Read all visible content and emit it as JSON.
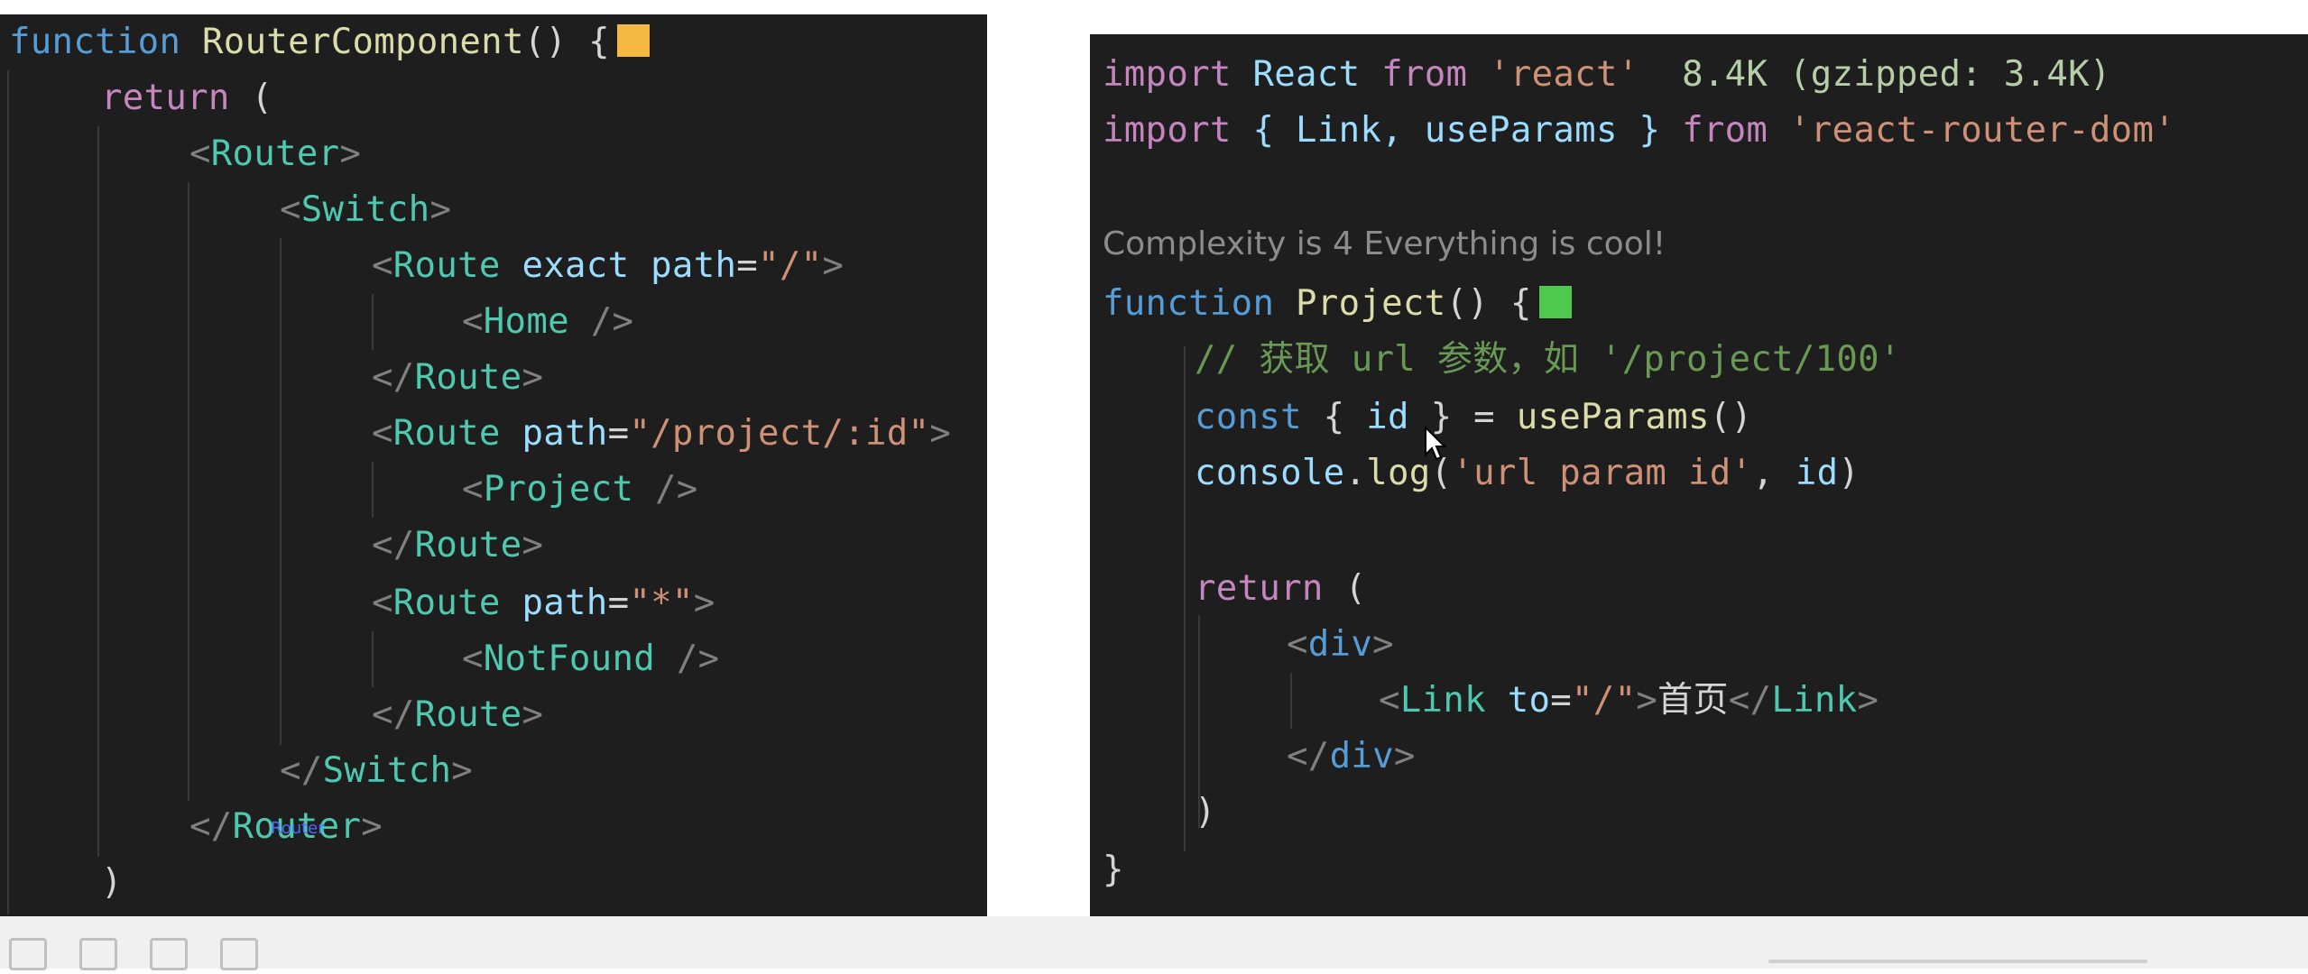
{
  "left_code": {
    "line1": {
      "kw": "function",
      "name": "RouterComponent",
      "rest": "() {"
    },
    "line2": {
      "kw": "return",
      "rest": " ("
    },
    "router_open": "Router",
    "switch_open": "Switch",
    "route1": {
      "tag": "Route",
      "attr1": "exact",
      "attr2": "path",
      "value": "\"/\""
    },
    "home": "Home",
    "route_close": "Route",
    "route2": {
      "tag": "Route",
      "attr": "path",
      "value": "\"/project/:id\""
    },
    "project": "Project",
    "route3": {
      "tag": "Route",
      "attr": "path",
      "value": "\"*\""
    },
    "notfound": "NotFound",
    "switch_close": "Switch",
    "router_close": "Router",
    "close_paren": ")",
    "close_brace": "}",
    "swatch_color": "#f5b942"
  },
  "right_code": {
    "import1": {
      "kw": "import",
      "name": "React",
      "from": "from",
      "module": "'react'",
      "size": "8.4K (gzipped: 3.4K)"
    },
    "import2": {
      "kw": "import",
      "names": "{ Link, useParams }",
      "from": "from",
      "module": "'react-router-dom'"
    },
    "lint_message": "Complexity is 4 Everything is cool!",
    "fn_line": {
      "kw": "function",
      "name": "Project",
      "rest": "() {"
    },
    "comment": "// 获取 url 参数，如 '/project/100'",
    "const_line": {
      "kw": "const",
      "open": " { ",
      "var": "id",
      "close": " } = ",
      "call": "useParams",
      "args": "()"
    },
    "console_line": {
      "obj": "console",
      "dot": ".",
      "method": "log",
      "open": "(",
      "str": "'url param id'",
      "sep": ", ",
      "var": "id",
      "close": ")"
    },
    "return_line": {
      "kw": "return",
      "rest": " ("
    },
    "div_open": "div",
    "link_line": {
      "tag": "Link",
      "attr": "to",
      "value": "\"/\"",
      "text": "首页",
      "close_tag": "Link"
    },
    "div_close": "div",
    "close_paren": ")",
    "close_brace": "}",
    "swatch_color": "#4ec94e"
  },
  "overlay_text": "Router"
}
